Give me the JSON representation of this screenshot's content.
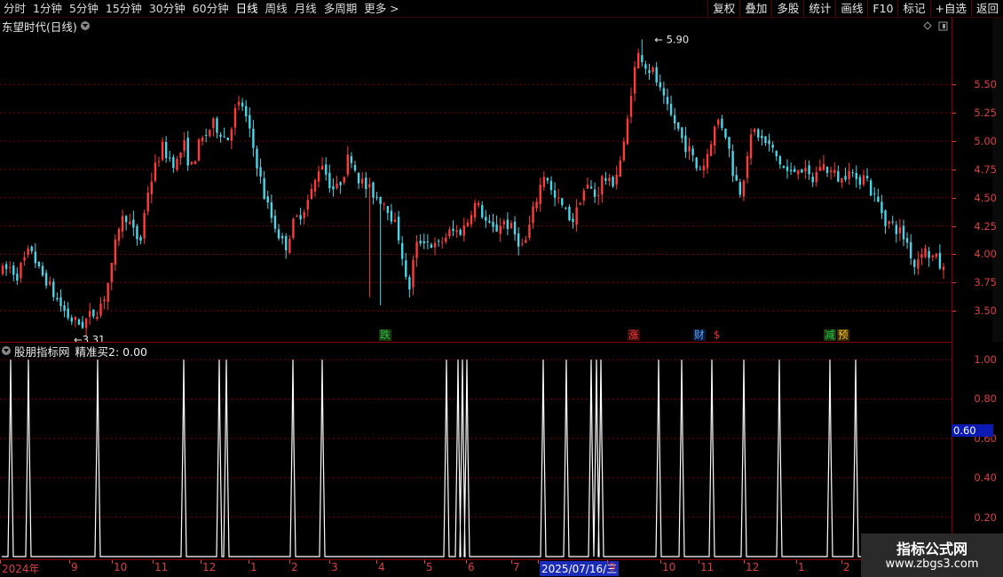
{
  "toolbar": {
    "left": [
      "分时",
      "1分钟",
      "5分钟",
      "15分钟",
      "30分钟",
      "60分钟",
      "日线",
      "周线",
      "月线",
      "多周期",
      "更多 >"
    ],
    "active": "日线",
    "right": [
      "复权",
      "叠加",
      "多股",
      "统计",
      "画线",
      "F10",
      "标记",
      "+自选",
      "返回"
    ]
  },
  "main": {
    "title": "东望时代(日线)",
    "high_label": "5.90",
    "low_label": "3.31",
    "y_ticks": [
      "5.50",
      "5.25",
      "5.00",
      "4.75",
      "4.50",
      "4.25",
      "4.00",
      "3.75",
      "3.50"
    ],
    "events": [
      {
        "text": "跌",
        "color": "#24c24a",
        "bg": "#1c3a10"
      },
      {
        "text": "涨",
        "color": "#ff4040",
        "bg": "#3a0a0a"
      },
      {
        "text": "财",
        "color": "#5aa9ff",
        "bg": "#0a1a3a"
      },
      {
        "text": "$",
        "color": "#ff3030",
        "bg": "#000000"
      },
      {
        "text": "减",
        "color": "#24c24a",
        "bg": "#1c3a10"
      },
      {
        "text": "预",
        "color": "#ffcc33",
        "bg": "#3a2a00"
      }
    ]
  },
  "indicator": {
    "title": "股朋指标网",
    "series_label": "精准买2: 0.00",
    "y_ticks": [
      "1.00",
      "0.80",
      "0.60",
      "0.40",
      "0.20"
    ],
    "current_badge": "0.60"
  },
  "date_axis": [
    "2024年",
    "9",
    "10",
    "11",
    "12",
    "1",
    "2",
    "3",
    "4",
    "5",
    "6",
    "7",
    "2025/07/16/三",
    "9",
    "10",
    "11",
    "12",
    "1",
    "2"
  ],
  "watermark": {
    "line1": "指标公式网",
    "line2": "www.zbgs3.com"
  },
  "colors": {
    "up": "#ff3a3a",
    "down": "#4ad6e8",
    "grid": "#8a0000",
    "axis_text": "#d84040"
  },
  "chart_data": [
    {
      "type": "candlestick",
      "title": "东望时代(日线)",
      "ylim": [
        3.25,
        5.95
      ],
      "y_ticks": [
        3.5,
        3.75,
        4.0,
        4.25,
        4.5,
        4.75,
        5.0,
        5.25,
        5.5
      ],
      "annotations": [
        {
          "label": "5.90",
          "type": "high"
        },
        {
          "label": "3.31",
          "type": "low"
        }
      ],
      "close_path": [
        3.85,
        3.88,
        3.82,
        3.95,
        4.05,
        3.85,
        3.78,
        3.65,
        3.55,
        3.45,
        3.4,
        3.38,
        3.45,
        3.5,
        3.62,
        3.85,
        4.25,
        4.35,
        4.2,
        4.1,
        4.55,
        4.75,
        4.95,
        4.85,
        4.8,
        4.98,
        4.75,
        4.95,
        5.05,
        5.15,
        5.1,
        5.0,
        5.25,
        5.35,
        5.1,
        4.85,
        4.55,
        4.35,
        4.2,
        4.05,
        4.25,
        4.35,
        4.45,
        4.6,
        4.85,
        4.65,
        4.55,
        4.7,
        4.9,
        4.7,
        4.6,
        4.55,
        4.5,
        4.45,
        4.3,
        4.1,
        3.62,
        4.05,
        4.15,
        4.1,
        4.05,
        4.15,
        4.2,
        4.2,
        4.25,
        4.45,
        4.4,
        4.25,
        4.2,
        4.3,
        4.25,
        4.15,
        4.05,
        4.3,
        4.55,
        4.75,
        4.5,
        4.45,
        4.35,
        4.3,
        4.55,
        4.6,
        4.5,
        4.7,
        4.6,
        4.75,
        5.0,
        5.55,
        5.8,
        5.65,
        5.6,
        5.4,
        5.25,
        5.15,
        5.0,
        4.9,
        4.75,
        4.8,
        5.05,
        5.2,
        5.05,
        4.7,
        4.55,
        4.95,
        5.1,
        5.0,
        4.95,
        4.85,
        4.75,
        4.7,
        4.8,
        4.7,
        4.65,
        4.8,
        4.75,
        4.7,
        4.65,
        4.8,
        4.6,
        4.75,
        4.55,
        4.45,
        4.3,
        4.25,
        4.2,
        4.1,
        3.9,
        4.05,
        4.0,
        3.95,
        3.85
      ]
    },
    {
      "type": "line",
      "title": "股朋指标网",
      "series": [
        {
          "name": "精准买2",
          "current": 0.0
        }
      ],
      "ylim": [
        0,
        1.05
      ],
      "y_ticks": [
        0.2,
        0.4,
        0.6,
        0.8,
        1.0
      ],
      "spikes_count": 30
    }
  ]
}
